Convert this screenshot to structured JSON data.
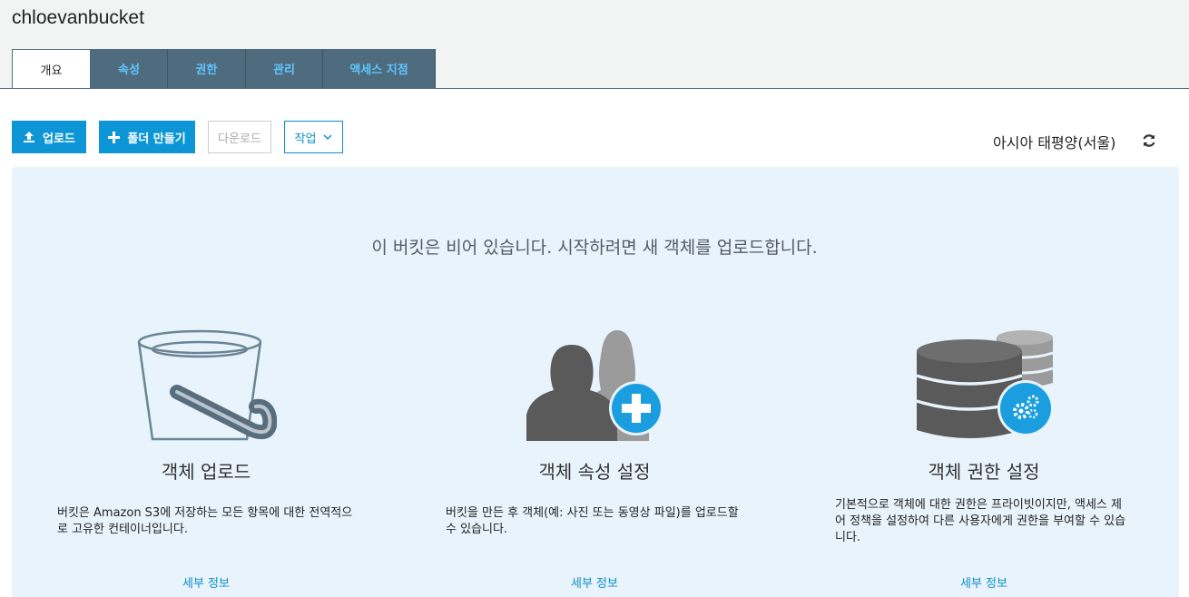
{
  "bucket": {
    "name": "chloevanbucket"
  },
  "tabs": [
    {
      "label": "개요",
      "active": true
    },
    {
      "label": "속성",
      "active": false
    },
    {
      "label": "권한",
      "active": false
    },
    {
      "label": "관리",
      "active": false
    },
    {
      "label": "액세스 지점",
      "active": false
    }
  ],
  "toolbar": {
    "upload_label": "업로드",
    "create_folder_label": "폴더 만들기",
    "download_label": "다운로드",
    "actions_label": "작업",
    "region": "아시아 태평양(서울)"
  },
  "empty_state": {
    "message": "이 버킷은 비어 있습니다. 시작하려면 새 객체를 업로드합니다."
  },
  "cards": [
    {
      "icon": "bucket-icon",
      "title": "객체 업로드",
      "desc_line1": "버킷은 Amazon S3에 저장하는 모든 항목에 대한 전역적으",
      "desc_line2": "로 고유한 컨테이너입니다.",
      "link": "세부 정보"
    },
    {
      "icon": "users-add-icon",
      "title": "객체 속성 설정",
      "desc_line1": "버킷을 만든 후 객체(예: 사진 또는 동영상 파일)를 업로드할",
      "desc_line2": "수 있습니다.",
      "link": "세부 정보"
    },
    {
      "icon": "database-settings-icon",
      "title": "객체 권한 설정",
      "desc_line1": "기본적으로 객체에 대한 권한은 프라이빗이지만, 액세스 제",
      "desc_line2": "어 정책을 설정하여 다른 사용자에게 권한을 부여할 수 있습",
      "desc_line3": "니다.",
      "link": "세부 정보"
    }
  ],
  "colors": {
    "primary": "#0d96d6",
    "tab_bg": "#4f6b7e",
    "tab_text": "#5ec6ff",
    "panel_bg": "#e8f3fb",
    "icon_gray": "#5a5a5a",
    "icon_blue": "#1a9ee0"
  }
}
